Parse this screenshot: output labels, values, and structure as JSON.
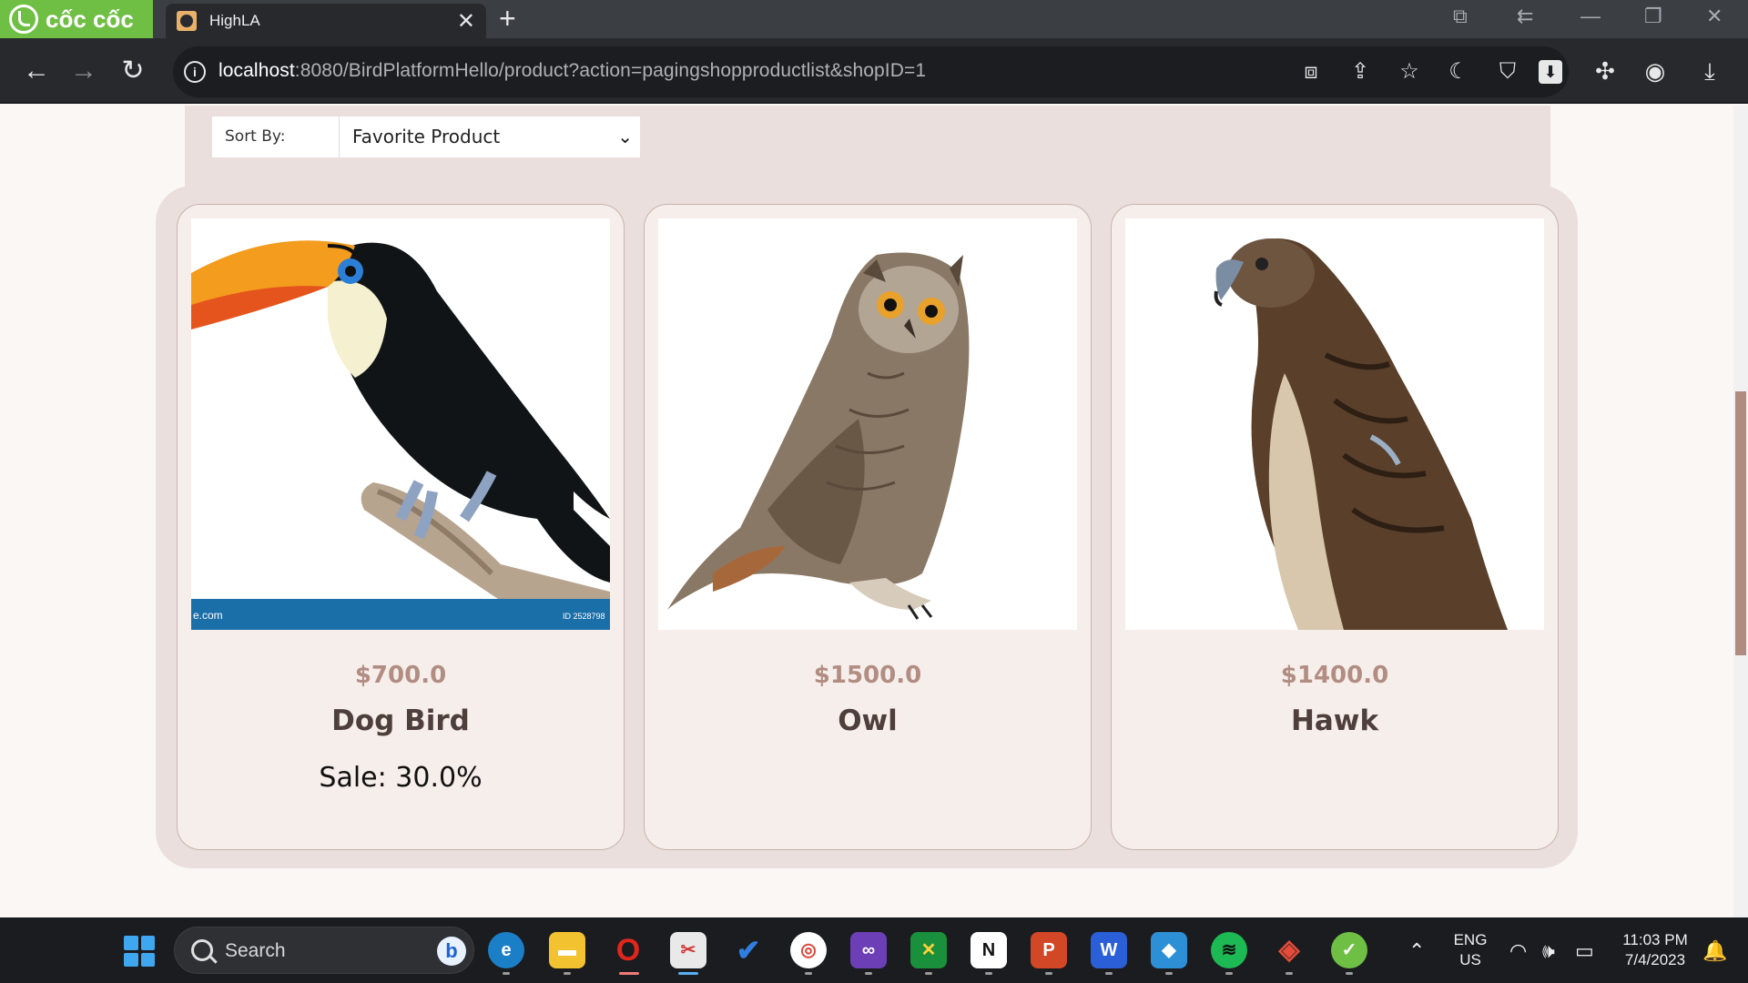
{
  "browser": {
    "brand": "cốc cốc",
    "tab_title": "HighLA",
    "tab_close": "✕",
    "new_tab": "+",
    "url_host": "localhost",
    "url_rest": ":8080/BirdPlatformHello/product?action=pagingshopproductlist&shopID=1",
    "toolbar_icons": [
      "translate-icon",
      "share-icon",
      "star-icon",
      "moon-icon",
      "shield-icon",
      "download-box-icon",
      "extensions-icon",
      "profile-icon",
      "download-icon"
    ]
  },
  "filter": {
    "sort_label": "Sort By:",
    "sort_value": "Favorite Product"
  },
  "products": [
    {
      "price": "$700.0",
      "name": "Dog Bird",
      "sale": "Sale: 30.0%",
      "image": "toucan",
      "watermark_left": "e.com",
      "watermark_right": "ID 2528798"
    },
    {
      "price": "$1500.0",
      "name": "Owl",
      "sale": "",
      "image": "owl"
    },
    {
      "price": "$1400.0",
      "name": "Hawk",
      "sale": "",
      "image": "hawk"
    }
  ],
  "taskbar": {
    "search_placeholder": "Search",
    "language_top": "ENG",
    "language_bottom": "US",
    "time": "11:03 PM",
    "date": "7/4/2023"
  },
  "colors": {
    "panel": "#eadfdc",
    "card": "#f6eeeb",
    "price": "#b18d82",
    "name": "#4e3f3c",
    "browser_dark": "#27292d",
    "brand_green": "#6fbf45"
  }
}
